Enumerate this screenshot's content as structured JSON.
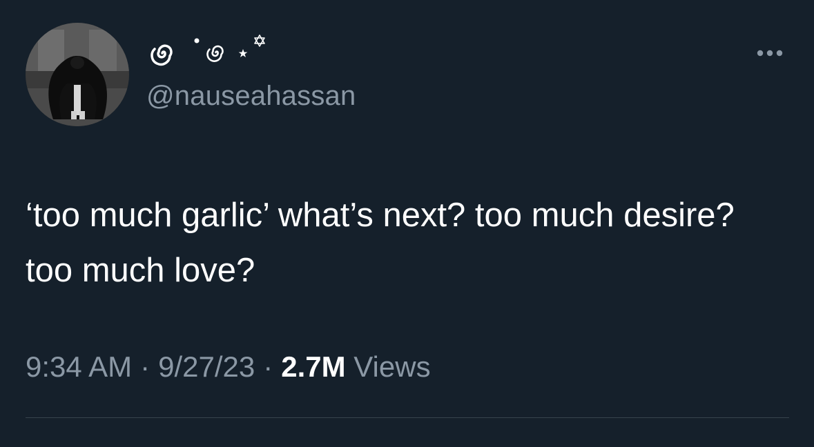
{
  "author": {
    "display_name_icons": [
      "spiral-icon",
      "dot-icon",
      "spiral-icon",
      "star-icon",
      "star-of-david-icon"
    ],
    "handle": "@nauseahassan",
    "avatar": "black-and-white-photo-avatar"
  },
  "tweet": {
    "text": "‘too much garlic’ what’s next? too much desire? too much love?"
  },
  "meta": {
    "time": "9:34 AM",
    "separator": "·",
    "date": "9/27/23",
    "views_count": "2.7M",
    "views_label": "Views"
  },
  "icons": {
    "more": "more-horizontal-icon"
  },
  "colors": {
    "background": "#15202b",
    "primary_text": "#ffffff",
    "secondary_text": "#8b98a5",
    "divider": "#38444d"
  }
}
